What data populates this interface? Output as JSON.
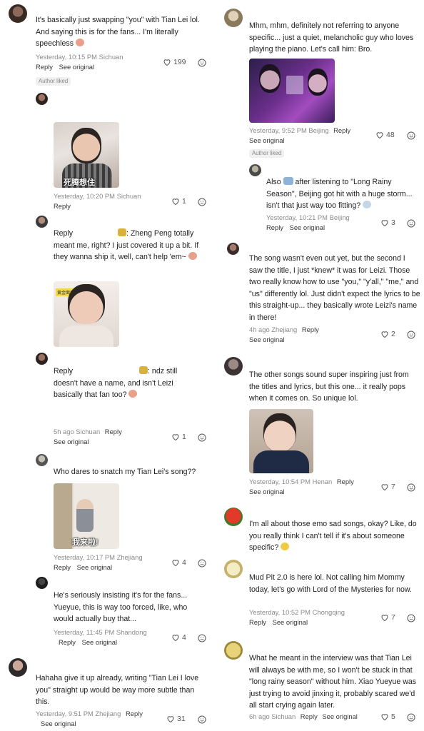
{
  "left": {
    "c1": {
      "text": "It's basically just swapping \"you\" with Tian Lei lol. And saying this is for the fans... I'm literally speechless",
      "time": "Yesterday, 10:15 PM",
      "loc": "Sichuan",
      "reply": "Reply",
      "see": "See original",
      "likes": "199",
      "badge": "Author liked"
    },
    "c2": {
      "time": "Yesterday, 10:20 PM",
      "loc": "Sichuan",
      "reply": "Reply",
      "likes": "1",
      "sticker_text": "死腾想住"
    },
    "c3": {
      "reply_prefix": "Reply",
      "mention": ": Zheng Peng",
      "text": "totally meant me, right? I just covered it up a bit. If they wanna ship it, well, can't help 'em~",
      "sticker_text": "黄金面相"
    },
    "c4": {
      "reply_prefix": "Reply",
      "mention": ": ndz still",
      "text": "doesn't have a name, and isn't Leizi basically that fan too?",
      "time": "5h ago",
      "loc": "Sichuan",
      "reply": "Reply",
      "see": "See original",
      "likes": "1"
    },
    "c5": {
      "text": "Who dares to snatch my Tian Lei's song??",
      "sticker_text": "我来啦!",
      "time": "Yesterday, 10:17 PM",
      "loc": "Zhejiang",
      "reply": "Reply",
      "see": "See original",
      "likes": "4"
    },
    "c6": {
      "text": "He's seriously insisting it's for the fans... Yueyue, this is way too forced, like, who would actually buy that...",
      "time": "Yesterday, 11:45 PM",
      "loc": "Shandong",
      "reply": "Reply",
      "see": "See original",
      "likes": "4"
    },
    "c7": {
      "text": "Hahaha give it up already, writing \"Tian Lei I love you\" straight up would be way more subtle than this.",
      "time": "Yesterday, 9:51 PM",
      "loc": "Zhejiang",
      "reply": "Reply",
      "see": "See original",
      "likes": "31"
    }
  },
  "right": {
    "r1": {
      "text": "Mhm, mhm, definitely not referring to anyone specific... just a quiet, melancholic guy who loves playing the piano. Let's call him: Bro.",
      "time": "Yesterday, 9:52 PM",
      "loc": "Beijing",
      "reply": "Reply",
      "see": "See original",
      "likes": "48",
      "badge": "Author liked"
    },
    "r2": {
      "text_a": "Also",
      "text_b": "after listening to \"Long Rainy Season\", Beijing got hit with a huge storm... isn't that just way too fitting?",
      "time": "Yesterday, 10:21 PM",
      "loc": "Beijing",
      "reply": "Reply",
      "see": "See original",
      "likes": "3"
    },
    "r3": {
      "text": "The song wasn't even out yet, but the second I saw the title, I just *knew* it was for Leizi. Those two really know how to use \"you,\" \"y'all,\" \"me,\" and \"us\" differently lol. Just didn't expect the lyrics to be this straight-up... they basically wrote Leizi's name in there!",
      "time": "4h ago",
      "loc": "Zhejiang",
      "reply": "Reply",
      "see": "See original",
      "likes": "2"
    },
    "r4": {
      "text": "The other songs sound super inspiring just from the titles and lyrics, but this one... it really pops when it comes on. So unique lol.",
      "time": "Yesterday, 10:54 PM",
      "loc": "Henan",
      "reply": "Reply",
      "see": "See original",
      "likes": "7"
    },
    "r5": {
      "text": "I'm all about those emo sad songs, okay? Like, do you really think I can't tell if it's about someone specific?"
    },
    "r6": {
      "text": "Mud Pit 2.0 is here lol. Not calling him Mommy today, let's go with Lord of the Mysteries for now.",
      "time": "Yesterday, 10:52 PM",
      "loc": "Chongqing",
      "reply": "Reply",
      "see": "See original",
      "likes": "7"
    },
    "r7": {
      "text": "What he meant in the interview was that Tian Lei will always be with me, so I won't be stuck in that \"long rainy season\" without him. Xiao Yueyue was just trying to avoid jinxing it, probably scared we'd all start crying again later.",
      "time": "6h ago",
      "loc": "Sichuan",
      "reply": "Reply",
      "see": "See original",
      "likes": "5"
    }
  }
}
